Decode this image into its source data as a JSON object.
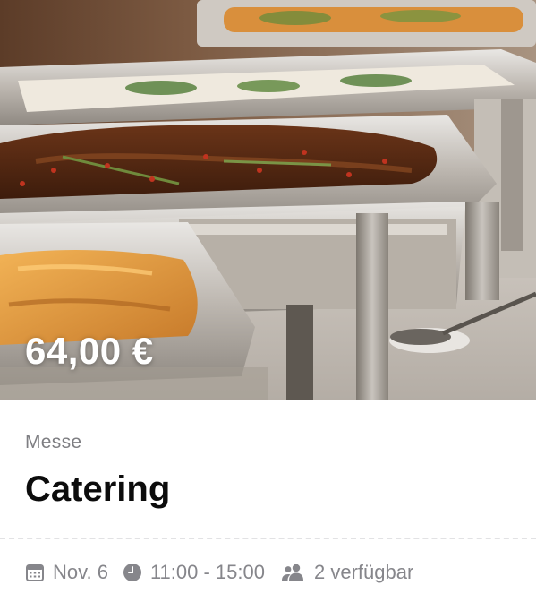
{
  "event": {
    "price": "64,00 €",
    "category": "Messe",
    "title": "Catering",
    "date": "Nov. 6",
    "time": "11:00 - 15:00",
    "availability": "2 verfügbar"
  },
  "icons": {
    "date": "calendar-icon",
    "time": "clock-icon",
    "availability": "people-icon"
  },
  "colors": {
    "muted_text": "#86868b",
    "title_text": "#0c0c0c",
    "price_text": "#ffffff"
  }
}
